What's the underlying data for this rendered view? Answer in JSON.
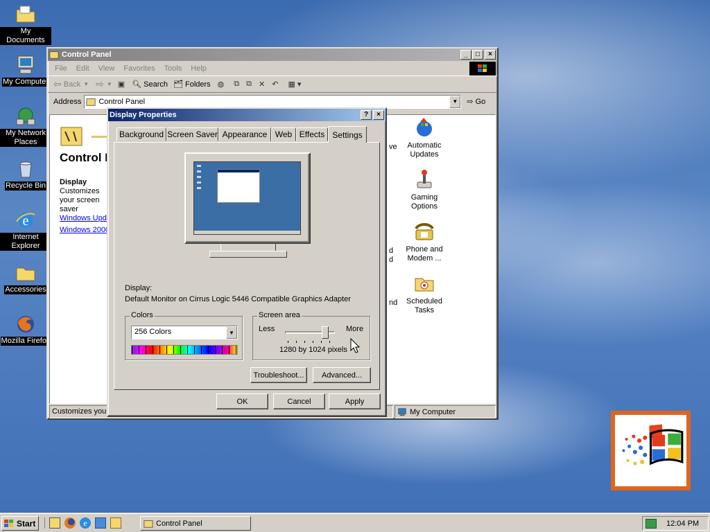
{
  "desktop_icons": [
    {
      "label": "My Documents"
    },
    {
      "label": "My Computer"
    },
    {
      "label": "My Network Places"
    },
    {
      "label": "Recycle Bin"
    },
    {
      "label": "Internet Explorer"
    },
    {
      "label": "Accessories"
    },
    {
      "label": "Mozilla Firefox"
    }
  ],
  "control_panel": {
    "title": "Control Panel",
    "menu": [
      "File",
      "Edit",
      "View",
      "Favorites",
      "Tools",
      "Help"
    ],
    "toolbar": {
      "back": "Back",
      "search": "Search",
      "folders": "Folders"
    },
    "address_label": "Address",
    "address_value": "Control Panel",
    "go": "Go",
    "left_heading": "Control P",
    "left_item_title": "Display",
    "left_item_desc": "Customizes your screen saver",
    "links": [
      "Windows Upda",
      "Windows 2000"
    ],
    "items": [
      {
        "label": "Automatic Updates"
      },
      {
        "label": "Gaming Options"
      },
      {
        "label": "Phone and Modem ..."
      },
      {
        "label": "Scheduled Tasks"
      }
    ],
    "partial_labels": [
      "ve",
      "d",
      "d",
      "nd"
    ],
    "status_left": "Customizes your",
    "status_right": "My Computer"
  },
  "dialog": {
    "title": "Display Properties",
    "help": "?",
    "close": "×",
    "tabs": [
      "Background",
      "Screen Saver",
      "Appearance",
      "Web",
      "Effects",
      "Settings"
    ],
    "active_tab": "Settings",
    "display_label": "Display:",
    "display_value": "Default Monitor on Cirrus Logic 5446 Compatible Graphics Adapter",
    "colors_group": "Colors",
    "colors_value": "256 Colors",
    "screen_area_group": "Screen area",
    "less": "Less",
    "more": "More",
    "resolution": "1280 by 1024 pixels",
    "slider_level": 0.85,
    "troubleshoot": "Troubleshoot...",
    "advanced": "Advanced...",
    "ok": "OK",
    "cancel": "Cancel",
    "apply": "Apply"
  },
  "taskbar": {
    "start": "Start",
    "task": "Control Panel",
    "clock": "12:04 PM"
  }
}
